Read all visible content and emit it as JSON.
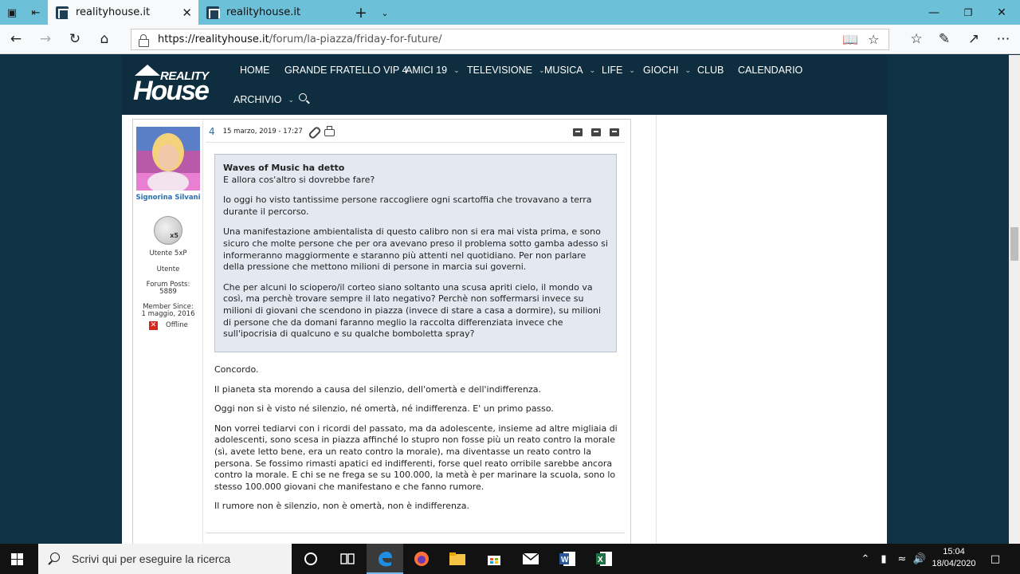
{
  "browser": {
    "tabs": [
      {
        "title": "realityhouse.it",
        "active": true
      },
      {
        "title": "realityhouse.it",
        "active": false
      }
    ],
    "url_host": "https://realityhouse.it",
    "url_path": "/forum/la-piazza/friday-for-future/",
    "window_controls": [
      "minimize",
      "maximize",
      "close"
    ]
  },
  "site": {
    "logo_top": "REALITY",
    "logo_bottom": "House",
    "menu": [
      {
        "label": "HOME",
        "has_dropdown": false
      },
      {
        "label": "GRANDE FRATELLO VIP 4",
        "has_dropdown": false
      },
      {
        "label": "AMICI 19",
        "has_dropdown": true
      },
      {
        "label": "TELEVISIONE",
        "has_dropdown": true
      },
      {
        "label": "MUSICA",
        "has_dropdown": true
      },
      {
        "label": "LIFE",
        "has_dropdown": true
      },
      {
        "label": "GIOCHI",
        "has_dropdown": true
      },
      {
        "label": "CLUB",
        "has_dropdown": false
      },
      {
        "label": "CALENDARIO",
        "has_dropdown": false
      },
      {
        "label": "ARCHIVIO",
        "has_dropdown": true
      }
    ]
  },
  "post": {
    "number": "4",
    "date": "15 marzo, 2019 - 17:27",
    "author": {
      "name": "Signorina Silvani",
      "rank_badge": "x5",
      "rank": "Utente 5xP",
      "role": "Utente",
      "posts_label": "Forum Posts:",
      "posts_value": "5889",
      "since_label": "Member Since:",
      "since_value": "1 maggio, 2016",
      "status": "Offline"
    },
    "quote": {
      "author_line": "Waves of Music ha detto",
      "first_line": "E allora cos'altro si dovrebbe fare?",
      "paragraphs": [
        "Io oggi ho visto tantissime persone raccogliere ogni scartoffia che trovavano a terra durante il percorso.",
        "Una manifestazione ambientalista di questo calibro non si era mai vista prima, e sono sicuro che molte persone che per ora avevano preso il problema sotto gamba adesso si informeranno maggiormente e staranno più attenti nel quotidiano. Per non parlare della pressione che mettono milioni di persone in marcia sui governi.",
        "Che per alcuni lo sciopero/il corteo siano soltanto una scusa apriti cielo, il mondo va così, ma perchè trovare sempre il lato negativo? Perchè non soffermarsi invece su milioni di giovani che scendono in piazza (invece di stare a casa a dormire), su milioni di persone che da domani faranno meglio la raccolta differenziata invece che sull'ipocrisia di qualcuno e su qualche bomboletta spray?"
      ]
    },
    "body": [
      "Concordo.",
      "Il pianeta sta morendo a causa del silenzio, dell'omertà e dell'indifferenza.",
      "Oggi non si è visto né silenzio, né omertà, né indifferenza. E' un primo passo.",
      "Non vorrei tediarvi con i ricordi del passato, ma da adolescente, insieme ad altre migliaia di adolescenti, sono scesa in piazza affinché lo stupro non fosse più un reato contro la morale (sì, avete letto bene, era un reato contro la morale), ma diventasse un reato contro la persona. Se fossimo rimasti apatici ed indifferenti, forse quel reato orribile sarebbe ancora contro la morale. E chi se ne frega se su 100.000, la metà è per marinare la scuola, sono lo stesso 100.000 giovani che manifestano e che fanno rumore.",
      "Il rumore non è silenzio, non è omertà, non è indifferenza."
    ]
  },
  "taskbar": {
    "search_placeholder": "Scrivi qui per eseguire la ricerca",
    "time": "15:04",
    "date": "18/04/2020"
  },
  "colors": {
    "site_header": "#0e2e40",
    "page_background": "#103245",
    "quote_background": "#e4e9f1",
    "author_link": "#2a6fb0",
    "tab_strip": "#6cc0d8"
  }
}
